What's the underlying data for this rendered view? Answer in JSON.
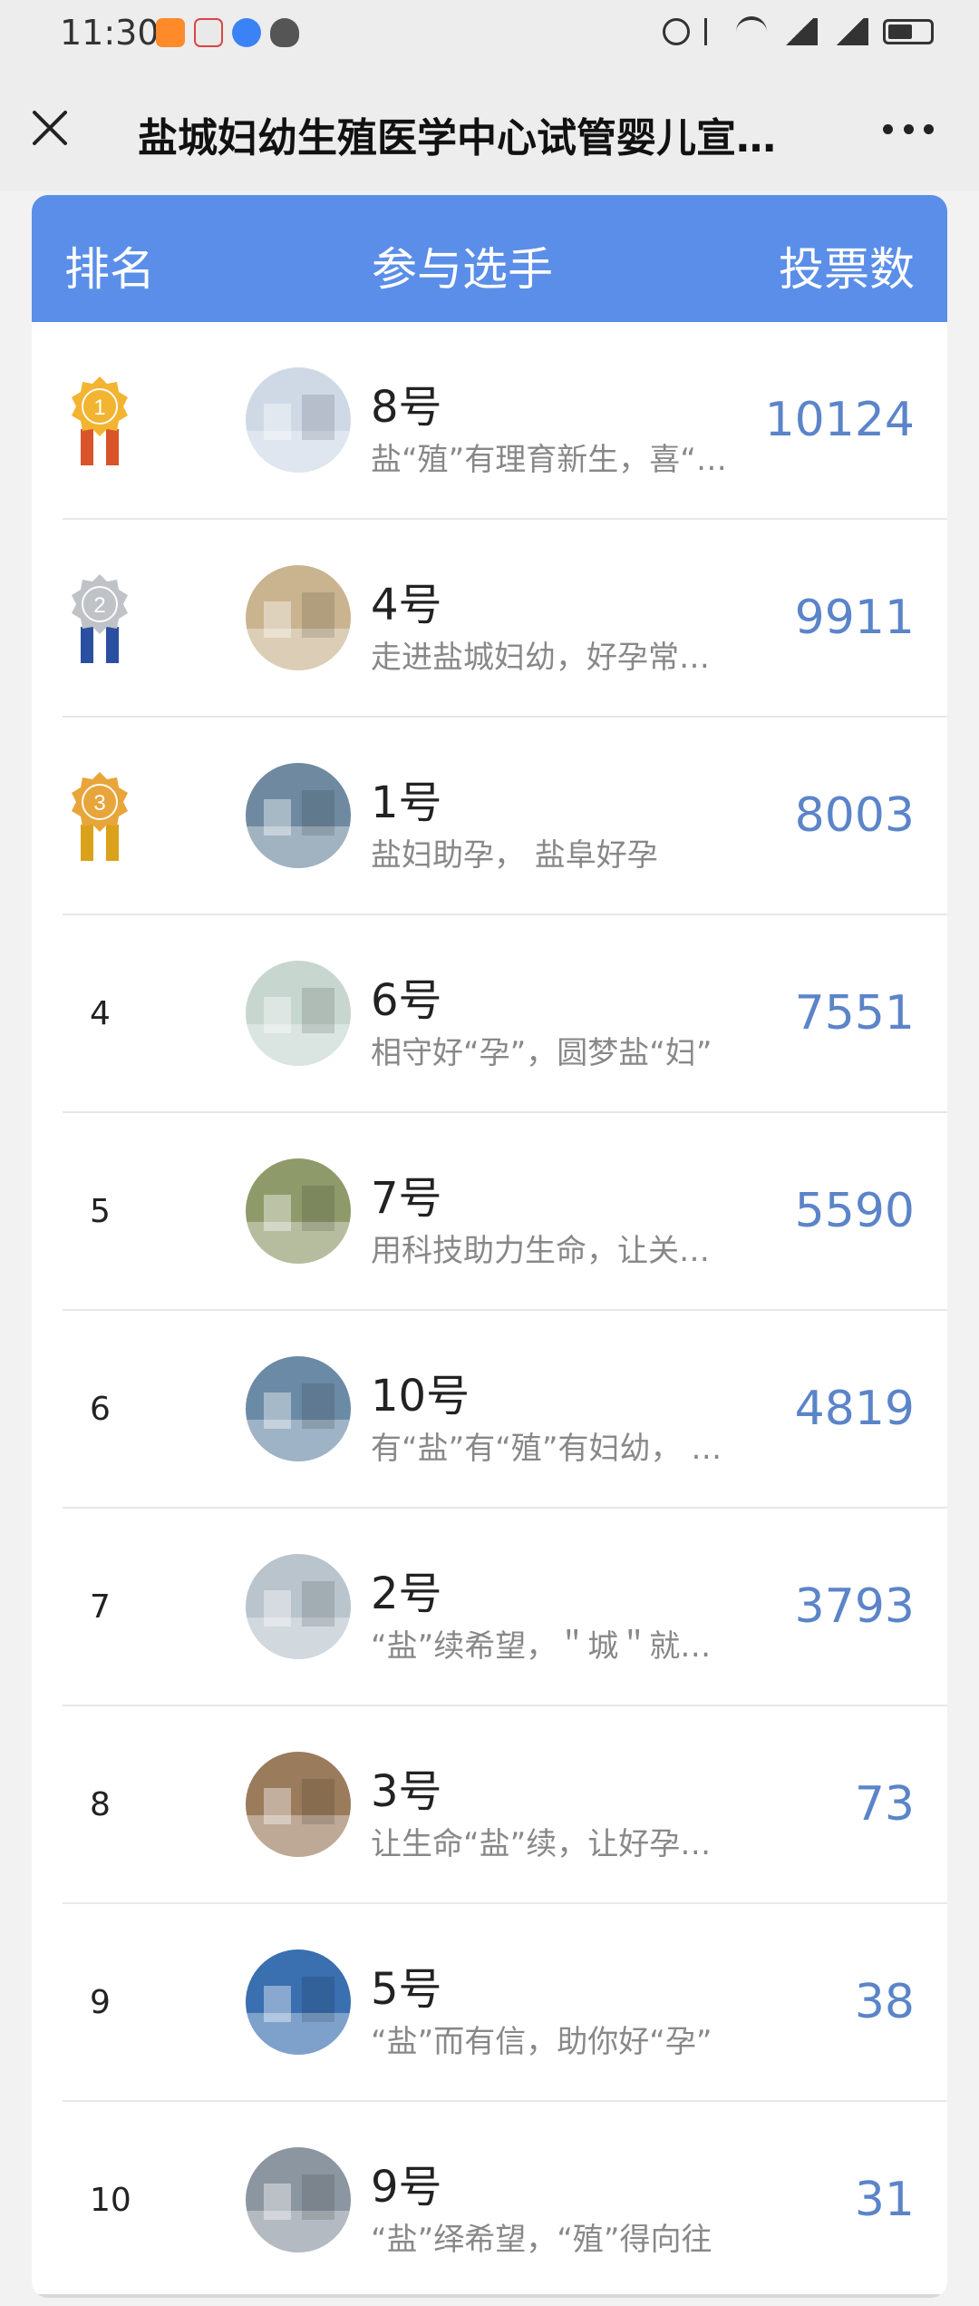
{
  "status_bar": {
    "time": "11:30"
  },
  "nav": {
    "title": "盐城妇幼生殖医学中心试管婴儿宣…"
  },
  "table": {
    "headers": {
      "rank": "排名",
      "player": "参与选手",
      "votes": "投票数"
    },
    "rows": [
      {
        "rank": "1",
        "medal": "gold",
        "name": "8号",
        "desc": "盐“殖”有理育新生，喜“…",
        "votes": "10124",
        "avatar_color": "#cfd9e6"
      },
      {
        "rank": "2",
        "medal": "silver",
        "name": "4号",
        "desc": "走进盐城妇幼，好孕常…",
        "votes": "9911",
        "avatar_color": "#c9b48f"
      },
      {
        "rank": "3",
        "medal": "bronze",
        "name": "1号",
        "desc": "盐妇助孕， 盐阜好孕",
        "votes": "8003",
        "avatar_color": "#6f8aa0"
      },
      {
        "rank": "4",
        "medal": "",
        "name": "6号",
        "desc": "相守好“孕”，圆梦盐“妇”",
        "votes": "7551",
        "avatar_color": "#c7d6cf"
      },
      {
        "rank": "5",
        "medal": "",
        "name": "7号",
        "desc": "用科技助力生命，让关…",
        "votes": "5590",
        "avatar_color": "#8f9a6a"
      },
      {
        "rank": "6",
        "medal": "",
        "name": "10号",
        "desc": "有“盐”有“殖”有妇幼， …",
        "votes": "4819",
        "avatar_color": "#6b8aa6"
      },
      {
        "rank": "7",
        "medal": "",
        "name": "2号",
        "desc": "“盐”续希望，＂城＂就…",
        "votes": "3793",
        "avatar_color": "#b9c4cc"
      },
      {
        "rank": "8",
        "medal": "",
        "name": "3号",
        "desc": "让生命“盐”续，让好孕…",
        "votes": "73",
        "avatar_color": "#9a7b5c"
      },
      {
        "rank": "9",
        "medal": "",
        "name": "5号",
        "desc": "“盐”而有信，助你好“孕”",
        "votes": "38",
        "avatar_color": "#3a6fb0"
      },
      {
        "rank": "10",
        "medal": "",
        "name": "9号",
        "desc": "“盐”绎希望，“殖”得向往",
        "votes": "31",
        "avatar_color": "#8c96a0"
      }
    ]
  },
  "colors": {
    "header_bg": "#5b8ee8",
    "vote_text": "#5b84c9",
    "gold": "#f2b431",
    "silver": "#bfc3c7",
    "bronze": "#e8a53a"
  }
}
